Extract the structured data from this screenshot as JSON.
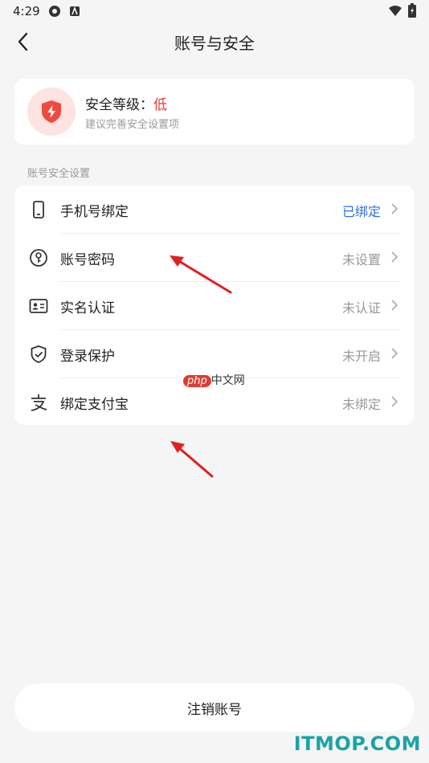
{
  "status_bar": {
    "time": "4:29"
  },
  "nav": {
    "title": "账号与安全"
  },
  "security_level": {
    "label": "安全等级：",
    "value": "低",
    "hint": "建议完善安全设置项",
    "accent": "#e53935"
  },
  "section": {
    "label": "账号安全设置"
  },
  "items": [
    {
      "label": "手机号绑定",
      "status": "已绑定",
      "icon": "phone-icon"
    },
    {
      "label": "账号密码",
      "status": "未设置",
      "icon": "key-icon"
    },
    {
      "label": "实名认证",
      "status": "未认证",
      "icon": "id-card-icon"
    },
    {
      "label": "登录保护",
      "status": "未开启",
      "icon": "shield-check-icon"
    },
    {
      "label": "绑定支付宝",
      "status": "未绑定",
      "icon": "alipay-icon"
    }
  ],
  "footer": {
    "cancel_label": "注销账号"
  },
  "watermark": {
    "php": "php",
    "cn": "中文网"
  },
  "brand_watermark": "ITMOP.COM",
  "colors": {
    "bound": "#2f6fe0",
    "muted": "#999999",
    "background": "#f5f5f5"
  }
}
